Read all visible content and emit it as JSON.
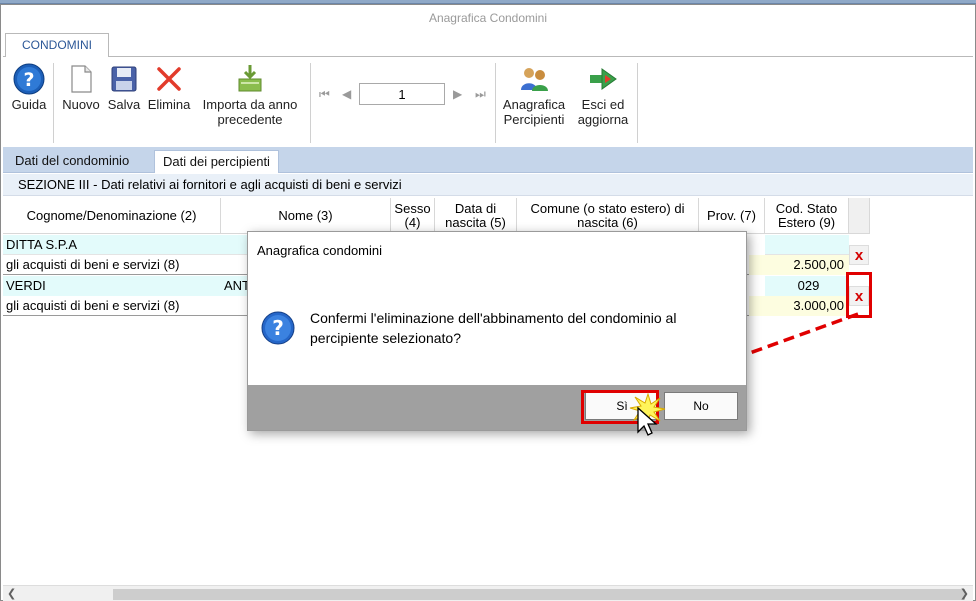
{
  "window": {
    "title": "Anagrafica Condomini"
  },
  "ribbon": {
    "tab": "CONDOMINI",
    "buttons": {
      "guida": "Guida",
      "nuovo": "Nuovo",
      "salva": "Salva",
      "elimina": "Elimina",
      "importa_l1": "Importa da anno",
      "importa_l2": "precedente",
      "anagrafica_l1": "Anagrafica",
      "anagrafica_l2": "Percipienti",
      "esci_l1": "Esci ed",
      "esci_l2": "aggiorna"
    },
    "page_number": "1"
  },
  "tabs": {
    "tab1": "Dati del condominio",
    "tab2": "Dati dei percipienti"
  },
  "section_title": "SEZIONE III - Dati relativi ai fornitori e agli acquisti di beni e servizi",
  "table": {
    "headers": {
      "cognome": "Cognome/Denominazione (2)",
      "nome": "Nome (3)",
      "sesso_l1": "Sesso",
      "sesso_l2": "(4)",
      "data_l1": "Data di",
      "data_l2": "nascita (5)",
      "comune_l1": "Comune (o stato estero) di",
      "comune_l2": "nascita (6)",
      "prov": "Prov. (7)",
      "cod_l1": "Cod. Stato",
      "cod_l2": "Estero (9)"
    },
    "rows": [
      {
        "cognome": "DITTA S.P.A",
        "nome": "",
        "cod": "",
        "sub_label": "gli acquisti di beni e servizi (8)",
        "importo": "2.500,00",
        "delete": "x"
      },
      {
        "cognome": "VERDI",
        "nome": "ANT",
        "cod": "029",
        "sub_label": "gli acquisti di beni e servizi (8)",
        "importo": "3.000,00",
        "delete": "x"
      }
    ]
  },
  "dialog": {
    "title": "Anagrafica condomini",
    "message_l1": "Confermi l'eliminazione dell'abbinamento del condominio al",
    "message_l2": "percipiente selezionato?",
    "yes": "Sì",
    "no": "No"
  },
  "colors": {
    "accent_red": "#e00000",
    "tab_bar": "#c5d5ea",
    "row_cyan": "#e3fbfb",
    "row_yellow": "#fdfde0"
  },
  "icons": [
    "help-icon",
    "new-document-icon",
    "save-icon",
    "delete-icon",
    "import-icon",
    "first-page-icon",
    "prev-page-icon",
    "next-page-icon",
    "last-page-icon",
    "people-icon",
    "exit-arrow-icon",
    "question-icon",
    "cursor-icon"
  ]
}
